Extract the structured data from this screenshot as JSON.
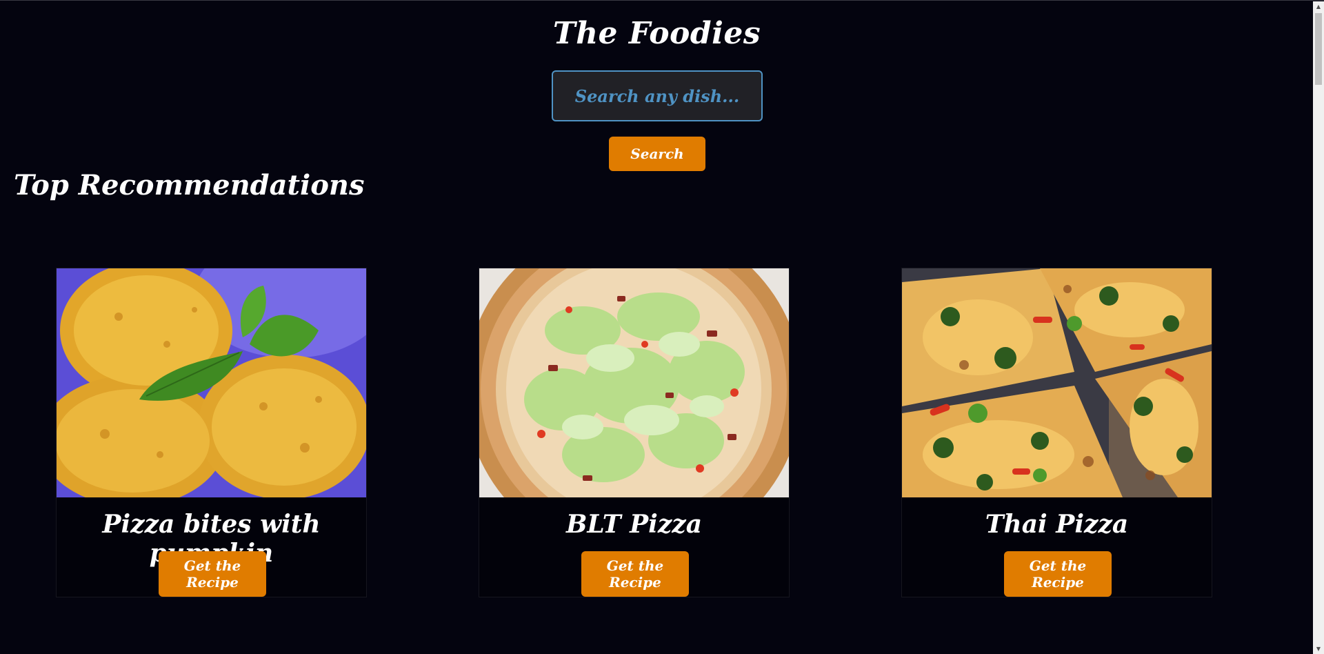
{
  "header": {
    "title": "The Foodies"
  },
  "search": {
    "placeholder": "Search any dish...",
    "value": "",
    "button_label": "Search"
  },
  "recommendations": {
    "heading": "Top Recommendations",
    "items": [
      {
        "title": "Pizza bites with pumpkin",
        "button_label": "Get the Recipe",
        "image": "pizza-bites-photo"
      },
      {
        "title": "BLT Pizza",
        "button_label": "Get the Recipe",
        "image": "blt-pizza-photo"
      },
      {
        "title": "Thai Pizza",
        "button_label": "Get the Recipe",
        "image": "thai-pizza-photo"
      }
    ]
  },
  "colors": {
    "background": "#04040f",
    "accent": "#e07c00",
    "search_border": "#4f93c4",
    "search_fill": "#212126",
    "text": "#ffffff"
  },
  "icons": {
    "scroll_up": "chevron-up-icon",
    "scroll_down": "chevron-down-icon"
  }
}
